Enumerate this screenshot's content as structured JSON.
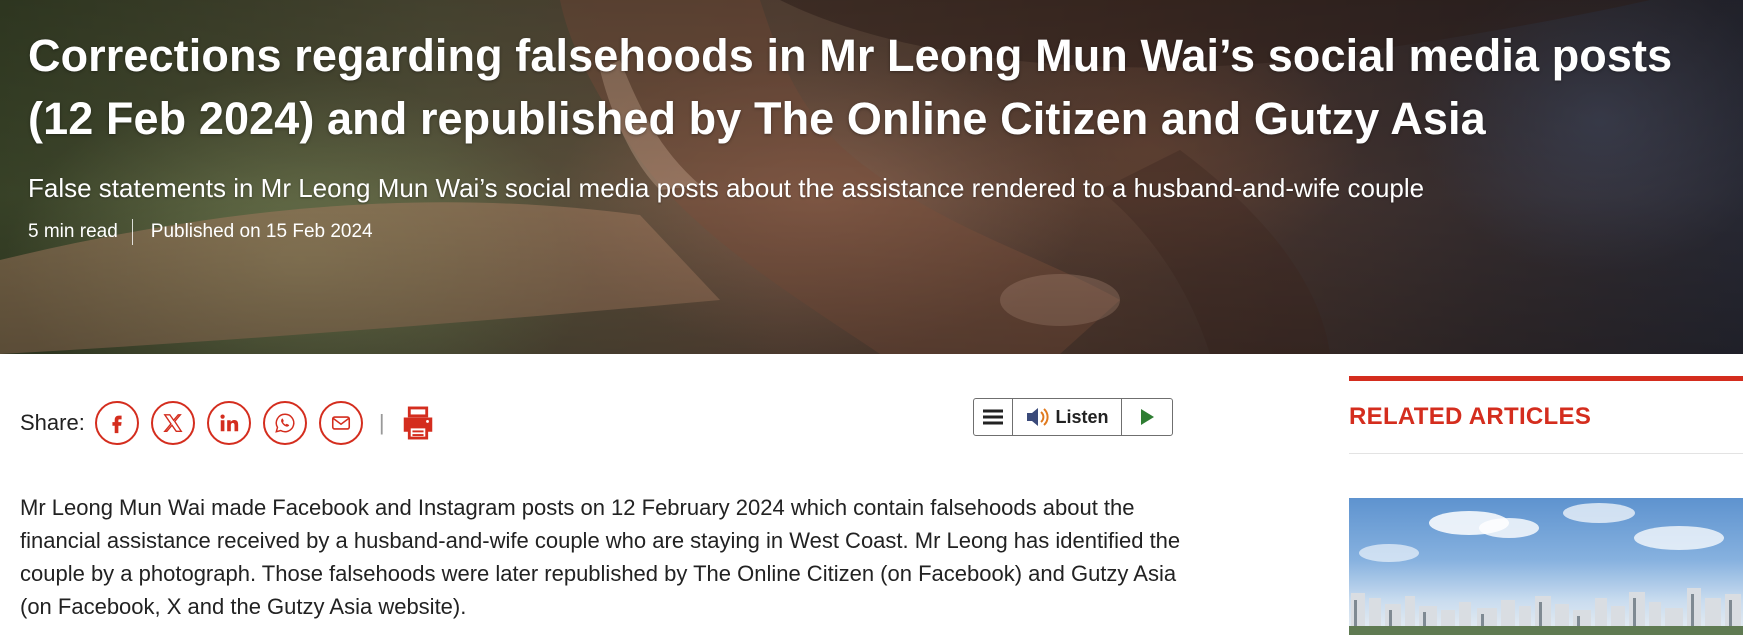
{
  "hero": {
    "title": "Corrections regarding falsehoods in Mr Leong Mun Wai’s social media posts (12 Feb 2024) and republished by The Online Citizen and Gutzy Asia",
    "subtitle": "False statements in Mr Leong Mun Wai’s social media posts about the assistance rendered to a husband-and-wife couple",
    "read_time": "5 min read",
    "published": "Published on 15 Feb 2024"
  },
  "share": {
    "label": "Share:",
    "separator": "|",
    "buttons": [
      {
        "name": "facebook",
        "icon": "facebook-icon"
      },
      {
        "name": "x",
        "icon": "x-icon"
      },
      {
        "name": "linkedin",
        "icon": "linkedin-icon"
      },
      {
        "name": "whatsapp",
        "icon": "whatsapp-icon"
      },
      {
        "name": "email",
        "icon": "mail-icon"
      }
    ],
    "print_icon": "printer-icon"
  },
  "listen": {
    "label": "Listen",
    "icons": [
      "menu-icon",
      "speaker-icon",
      "play-icon"
    ]
  },
  "article": {
    "paragraph": "Mr Leong Mun Wai made Facebook and Instagram posts on 12 February 2024 which contain falsehoods about the financial assistance received by a husband-and-wife couple who are staying in West Coast. Mr Leong has identified the couple by a photograph. Those falsehoods were later republished by The Online Citizen (on Facebook) and Gutzy Asia (on Facebook, X and the Gutzy Asia website)."
  },
  "sidebar": {
    "related_title": "RELATED ARTICLES"
  },
  "colors": {
    "accent": "#d42d1e",
    "text": "#222222",
    "play": "#2e7d32"
  }
}
